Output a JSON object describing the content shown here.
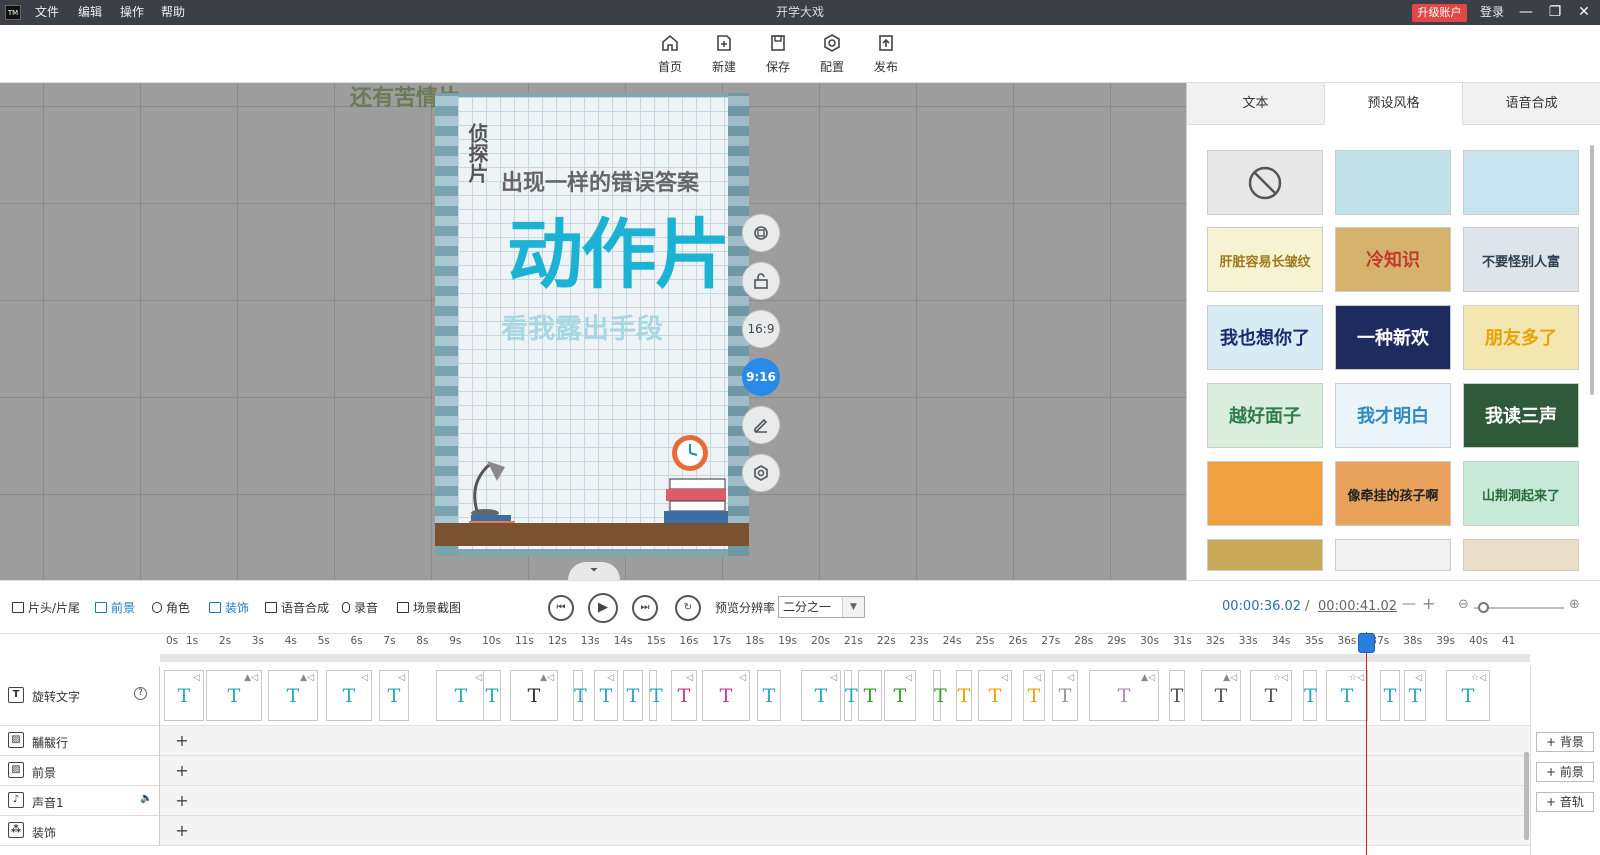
{
  "titlebar": {
    "logo": "TM",
    "menu": [
      "文件",
      "编辑",
      "操作",
      "帮助"
    ],
    "title": "开学大戏",
    "upgrade": "升级账户",
    "login": "登录",
    "min": "—",
    "max": "❐",
    "close": "✕"
  },
  "toolbar": {
    "items": [
      {
        "label": "首页",
        "icon": "home-icon"
      },
      {
        "label": "新建",
        "icon": "new-icon"
      },
      {
        "label": "保存",
        "icon": "save-icon"
      },
      {
        "label": "配置",
        "icon": "config-icon"
      },
      {
        "label": "发布",
        "icon": "publish-icon"
      }
    ]
  },
  "canvas": {
    "overlay_text": "还有苦情片",
    "poster": {
      "vertical_title": "侦探片",
      "line1": "出现一样的错误答案",
      "big": "动作片",
      "line3": "看我露出手段"
    },
    "side_buttons": {
      "ratio_169": "16:9",
      "ratio_916": "9:16"
    },
    "collapse": "⏷"
  },
  "right_panel": {
    "tabs": [
      "文本",
      "预设风格",
      "语音合成"
    ],
    "active_tab": 1,
    "thumbs": [
      {
        "text": "",
        "bg": "#e8e8e8",
        "color": "#555"
      },
      {
        "text": "",
        "bg": "#bfe3e6",
        "color": "#2a8a9a"
      },
      {
        "text": "",
        "bg": "#c8e4ee",
        "color": "#2a8a9a"
      },
      {
        "text": "肝脏容易长皱纹",
        "bg": "#f6f3d2",
        "color": "#a07a1c"
      },
      {
        "text": "冷知识",
        "bg": "#d6b36d",
        "color": "#c0392b"
      },
      {
        "text": "不要怪别人富",
        "bg": "#dfe4ea",
        "color": "#2c3e50"
      },
      {
        "text": "我也想你了",
        "bg": "#d7ecf4",
        "color": "#1a2a6c"
      },
      {
        "text": "一种新欢",
        "bg": "#1d2b5e",
        "color": "#ffffff"
      },
      {
        "text": "朋友多了",
        "bg": "#f3e6b0",
        "color": "#e6a400"
      },
      {
        "text": "越好面子",
        "bg": "#d9eedc",
        "color": "#2f7d4a"
      },
      {
        "text": "我才明白",
        "bg": "#eaf4fb",
        "color": "#2f89c7"
      },
      {
        "text": "我读三声",
        "bg": "#2f5a3a",
        "color": "#ffffff"
      },
      {
        "text": "",
        "bg": "#f0a040",
        "color": "#fff"
      },
      {
        "text": "像牵挂的孩子啊",
        "bg": "#e9a25c",
        "color": "#222"
      },
      {
        "text": "山荆洞起来了",
        "bg": "#c7ead8",
        "color": "#2a6a3a"
      },
      {
        "text": "",
        "bg": "#c9a95a",
        "color": "#333"
      },
      {
        "text": "",
        "bg": "#f1f1f1",
        "color": "#333"
      },
      {
        "text": "",
        "bg": "#eadfc8",
        "color": "#555"
      }
    ]
  },
  "controls": {
    "tabs": [
      "片头/片尾",
      "前景",
      "角色",
      "装饰",
      "语音合成",
      "录音",
      "场景截图"
    ],
    "resolution_label": "预览分辨率",
    "resolution_value": "二分之一",
    "time_current": "00:00:36.02",
    "time_sep": "/",
    "time_total": "00:00:41.02",
    "minus": "—",
    "plus": "+"
  },
  "ruler": {
    "ticks": [
      "0s",
      "1s",
      "2s",
      "3s",
      "4s",
      "5s",
      "6s",
      "7s",
      "8s",
      "9s",
      "10s",
      "11s",
      "12s",
      "13s",
      "14s",
      "15s",
      "16s",
      "17s",
      "18s",
      "19s",
      "20s",
      "21s",
      "22s",
      "23s",
      "24s",
      "25s",
      "26s",
      "27s",
      "28s",
      "29s",
      "30s",
      "31s",
      "32s",
      "33s",
      "34s",
      "35s",
      "36s",
      "37s",
      "38s",
      "39s",
      "40s",
      "41"
    ]
  },
  "tracks": [
    {
      "label": "旋转文字",
      "icon": "T",
      "help": "?"
    },
    {
      "label": "黼黻行",
      "icon": "▨",
      "add": "+"
    },
    {
      "label": "前景",
      "icon": "▨",
      "add": "+"
    },
    {
      "label": "声音1",
      "icon": "♪",
      "add": "+",
      "vol": "🔈"
    },
    {
      "label": "装饰",
      "icon": "⁂",
      "add": "+"
    }
  ],
  "clips": [
    {
      "c": "#2aa6c4",
      "s": "◁"
    },
    {
      "c": "#2aa6c4",
      "s": "▲◁"
    },
    {
      "c": "#2aa6c4",
      "s": "▲◁"
    },
    {
      "c": "#2aa6c4",
      "s": "◁"
    },
    {
      "c": "#2aa6c4",
      "s": "◁"
    },
    {
      "c": "#2aa6c4",
      "s": "◁"
    },
    {
      "c": "#2aa6c4",
      "s": ""
    },
    {
      "c": "#333333",
      "s": "▲◁"
    },
    {
      "c": "#2aa6c4",
      "s": ""
    },
    {
      "c": "#2aa6c4",
      "s": "◁"
    },
    {
      "c": "#2aa6c4",
      "s": ""
    },
    {
      "c": "#2aa6c4",
      "s": ""
    },
    {
      "c": "#c43c8a",
      "s": "◁"
    },
    {
      "c": "#c43c8a",
      "s": "◁"
    },
    {
      "c": "#2aa6c4",
      "s": ""
    },
    {
      "c": "#2aa6c4",
      "s": "◁"
    },
    {
      "c": "#2aa6c4",
      "s": ""
    },
    {
      "c": "#3a9a2a",
      "s": ""
    },
    {
      "c": "#3a9a2a",
      "s": "◁"
    },
    {
      "c": "#3a9a2a",
      "s": "◁"
    },
    {
      "c": "#e6a400",
      "s": ""
    },
    {
      "c": "#e6a400",
      "s": "◁"
    },
    {
      "c": "#e6a400",
      "s": "◁"
    },
    {
      "c": "#999999",
      "s": "◁"
    },
    {
      "c": "#b08ab0",
      "s": "▲◁"
    },
    {
      "c": "#555555",
      "s": ""
    },
    {
      "c": "#555555",
      "s": "▲◁"
    },
    {
      "c": "#555555",
      "s": "☆◁"
    },
    {
      "c": "#2aa6c4",
      "s": ""
    },
    {
      "c": "#2aa6c4",
      "s": "☆◁"
    },
    {
      "c": "#2aa6c4",
      "s": ""
    },
    {
      "c": "#2aa6c4",
      "s": "◁"
    },
    {
      "c": "#2aa6c4",
      "s": "☆◁"
    }
  ],
  "clip_text": "T",
  "side_add": [
    "背景",
    "前景",
    "音轨"
  ]
}
